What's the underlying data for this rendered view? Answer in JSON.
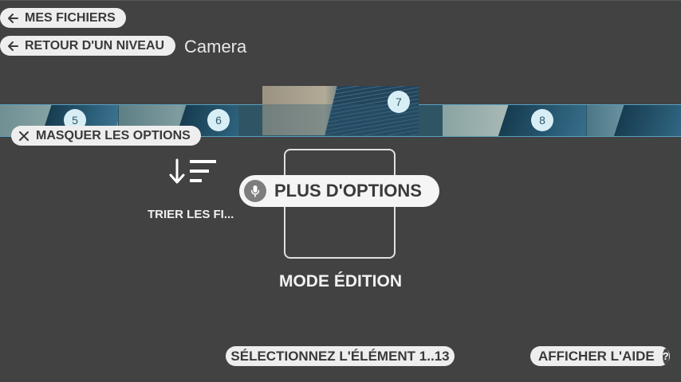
{
  "nav": {
    "my_files_label": "MES FICHIERS",
    "back_label": "RETOUR D'UN NIVEAU",
    "current_folder": "Camera"
  },
  "strip": {
    "thumbnails": [
      {
        "number": "5"
      },
      {
        "number": "6"
      },
      {
        "number": "7"
      },
      {
        "number": "8"
      }
    ]
  },
  "options": {
    "hide_label": "MASQUER LES OPTIONS",
    "sort_label": "TRIER LES FI...",
    "edit_mode_label": "MODE ÉDITION",
    "more_options_label": "PLUS D'OPTIONS"
  },
  "footer": {
    "select_label": "SÉLECTIONNEZ L'ÉLÉMENT 1..13",
    "help_label": "AFFICHER L'AIDE",
    "help_icon_glyph": "?"
  },
  "colors": {
    "background": "#424242",
    "pill": "#eeeeee",
    "strip_border": "#5aa0bf"
  }
}
